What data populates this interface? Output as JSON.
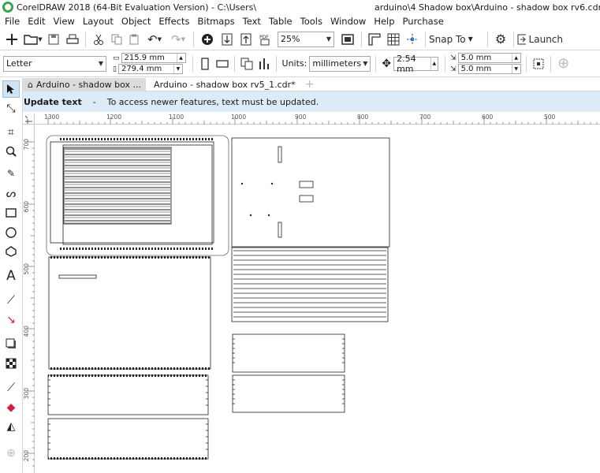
{
  "title": {
    "app": "CorelDRAW 2018 (64-Bit Evaluation Version) - C:\\Users\\",
    "path": "arduino\\4 Shadow box\\Arduino - shadow box rv6.cdr"
  },
  "menu": [
    "File",
    "Edit",
    "View",
    "Layout",
    "Object",
    "Effects",
    "Bitmaps",
    "Text",
    "Table",
    "Tools",
    "Window",
    "Help",
    "Purchase"
  ],
  "toolbar": {
    "zoom": "25%",
    "snap_label": "Snap To",
    "launch_label": "Launch"
  },
  "properties": {
    "page_size": "Letter",
    "width": "215.9 mm",
    "height": "279.4 mm",
    "units_label": "Units:",
    "units_value": "millimeters",
    "nudge": "2.54 mm",
    "dup_x": "5.0 mm",
    "dup_y": "5.0 mm"
  },
  "tabs": {
    "tab1": "Arduino - shadow box ...",
    "tab2": "Arduino - shadow box rv5_1.cdr*"
  },
  "notice": {
    "title": "Update text",
    "dash": "-",
    "message": "To access newer features, text must be updated."
  },
  "ruler": {
    "top": [
      "1300",
      "1200",
      "1100",
      "1000",
      "900",
      "800",
      "700",
      "600",
      "500"
    ],
    "left": [
      "700",
      "600",
      "500",
      "400",
      "300",
      "200"
    ]
  },
  "colors": {
    "notice_bg": "#dcebf6",
    "accent": "#3aa54a"
  },
  "icons": {
    "pick": "pick-tool-icon",
    "zoom": "zoom-tool-icon",
    "text": "text-tool-icon"
  }
}
